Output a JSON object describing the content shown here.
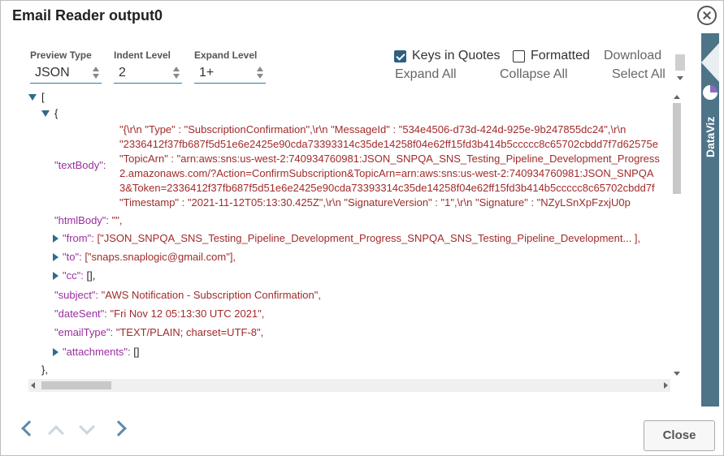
{
  "dialog": {
    "title": "Email Reader output0"
  },
  "controls": {
    "preview_type": {
      "label": "Preview Type",
      "value": "JSON"
    },
    "indent_level": {
      "label": "Indent Level",
      "value": "2"
    },
    "expand_level": {
      "label": "Expand Level",
      "value": "1+"
    }
  },
  "options": {
    "keys_in_quotes": {
      "label": "Keys in Quotes",
      "checked": true
    },
    "formatted": {
      "label": "Formatted",
      "checked": false
    },
    "download": "Download",
    "expand_all": "Expand All",
    "collapse_all": "Collapse All",
    "select_all": "Select All"
  },
  "tree": {
    "open_bracket": "[",
    "open_brace": "{",
    "close_brace": "},",
    "text_body": {
      "key": "\"textBody\":",
      "lines": [
        "\"{\\r\\n \"Type\" : \"SubscriptionConfirmation\",\\r\\n \"MessageId\" : \"534e4506-d73d-424d-925e-9b247855dc24\",\\r\\n",
        "\"2336412f37fb687f5d51e6e2425e90cda73393314c35de14258f04e62ff15fd3b414b5ccccc8c65702cbdd7f7d62575e",
        "\"TopicArn\" : \"arn:aws:sns:us-west-2:740934760981:JSON_SNPQA_SNS_Testing_Pipeline_Development_Progress",
        "2.amazonaws.com/?Action=ConfirmSubscription&TopicArn=arn:aws:sns:us-west-2:740934760981:JSON_SNPQA",
        "3&Token=2336412f37fb687f5d51e6e2425e90cda73393314c35de14258f04e62ff15fd3b414b5ccccc8c65702cbdd7f",
        "\"Timestamp\" : \"2021-11-12T05:13:30.425Z\",\\r\\n \"SignatureVersion\" : \"1\",\\r\\n \"Signature\" : \"NZyLSnXpFzxjU0p"
      ]
    },
    "html_body": {
      "key": "\"htmlBody\":",
      "value": "\"\","
    },
    "from": {
      "key": "\"from\":",
      "value": "[\"JSON_SNPQA_SNS_Testing_Pipeline_Development_Progress_SNPQA_SNS_Testing_Pipeline_Development... ],"
    },
    "to": {
      "key": "\"to\":",
      "value": "[\"snaps.snaplogic@gmail.com\"],"
    },
    "cc": {
      "key": "\"cc\":",
      "value": "[],"
    },
    "subject": {
      "key": "\"subject\":",
      "value": "\"AWS Notification - Subscription Confirmation\","
    },
    "date_sent": {
      "key": "\"dateSent\":",
      "value": "\"Fri Nov 12 05:13:30 UTC 2021\","
    },
    "email_type": {
      "key": "\"emailType\":",
      "value": "\"TEXT/PLAIN; charset=UTF-8\","
    },
    "attachments": {
      "key": "\"attachments\":",
      "value": "[]"
    }
  },
  "sidebar": {
    "label": "DataViz"
  },
  "footer": {
    "close_label": "Close"
  },
  "colors": {
    "key": "#9b2ea0",
    "string": "#a12b2b",
    "accent": "#4e7488"
  }
}
